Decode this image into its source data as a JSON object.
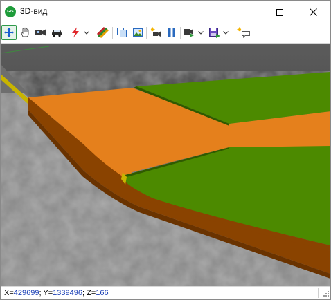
{
  "window": {
    "title": "3D-вид",
    "app_icon_text": "GIS"
  },
  "toolbar": {
    "buttons": [
      {
        "name": "move-tool",
        "icon": "four-arrows-icon",
        "active": true
      },
      {
        "name": "pan-tool",
        "icon": "hand-icon"
      },
      {
        "name": "camera-tool",
        "icon": "camera-icon"
      },
      {
        "name": "car-tool",
        "icon": "car-icon"
      },
      {
        "name": "lightning-tool",
        "icon": "lightning-icon",
        "dropdown": true
      },
      {
        "name": "palette-tool",
        "icon": "palette-icon"
      },
      {
        "name": "copy-tool",
        "icon": "copy-icon"
      },
      {
        "name": "image-tool",
        "icon": "picture-icon"
      },
      {
        "name": "light-camera-tool",
        "icon": "sun-camera-icon"
      },
      {
        "name": "pause-tool",
        "icon": "pause-icon"
      },
      {
        "name": "play-camera-tool",
        "icon": "play-camera-icon",
        "dropdown": true
      },
      {
        "name": "save-view-tool",
        "icon": "save-icon",
        "dropdown": true
      },
      {
        "name": "comment-tool",
        "icon": "sun-comment-icon"
      }
    ]
  },
  "status": {
    "x_label": "X=",
    "x_value": "429699",
    "sep1": "; ",
    "y_label": "Y=",
    "y_value": "1339496",
    "sep2": "; ",
    "z_label": "Z=",
    "z_value": "166"
  },
  "colors": {
    "sky": "#5c5c5c",
    "ground": "#9a9a9a",
    "orange": "#e67e1a",
    "orange_side": "#8a4200",
    "green": "#4a8a00",
    "yellow_edge": "#d8c200",
    "accent_border": "#2f9a4a"
  }
}
